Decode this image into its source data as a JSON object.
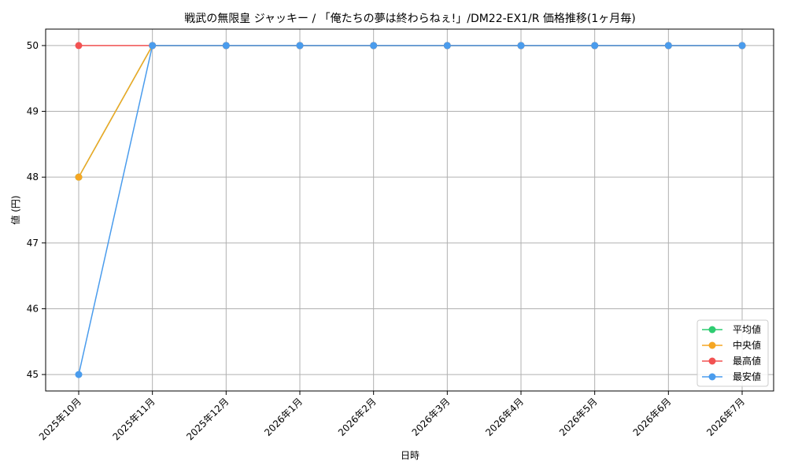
{
  "chart_data": {
    "type": "line",
    "title": "戦武の無限皇 ジャッキー / 「俺たちの夢は終わらねぇ!」/DM22-EX1/R 価格推移(1ヶ月毎)",
    "xlabel": "日時",
    "ylabel": "値 (円)",
    "categories": [
      "2025年10月",
      "2025年11月",
      "2025年12月",
      "2026年1月",
      "2026年2月",
      "2026年3月",
      "2026年4月",
      "2026年5月",
      "2026年6月",
      "2026年7月"
    ],
    "ylim": [
      44.75,
      50.25
    ],
    "yticks": [
      45,
      46,
      47,
      48,
      49,
      50
    ],
    "grid": true,
    "legend_position": "bottom-right",
    "series": [
      {
        "name": "平均値",
        "color": "#2ecc71",
        "values": [
          48,
          50,
          50,
          50,
          50,
          50,
          50,
          50,
          50,
          50
        ]
      },
      {
        "name": "中央値",
        "color": "#f5a623",
        "values": [
          48,
          50,
          50,
          50,
          50,
          50,
          50,
          50,
          50,
          50
        ]
      },
      {
        "name": "最高値",
        "color": "#f25252",
        "values": [
          50,
          50,
          50,
          50,
          50,
          50,
          50,
          50,
          50,
          50
        ]
      },
      {
        "name": "最安値",
        "color": "#4a9ced",
        "values": [
          45,
          50,
          50,
          50,
          50,
          50,
          50,
          50,
          50,
          50
        ]
      }
    ]
  }
}
